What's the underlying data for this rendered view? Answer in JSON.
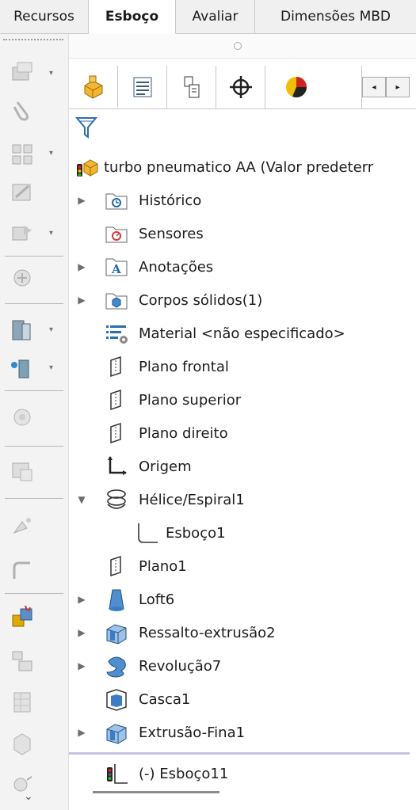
{
  "tabs": [
    {
      "label": "Recursos",
      "active": false
    },
    {
      "label": "Esboço",
      "active": true
    },
    {
      "label": "Avaliar",
      "active": false
    },
    {
      "label": "Dimensões MBD",
      "active": false
    }
  ],
  "feature_manager": {
    "tabs": [
      {
        "icon": "feature-manager-icon",
        "active": true
      },
      {
        "icon": "property-manager-icon",
        "active": false
      },
      {
        "icon": "configuration-manager-icon",
        "active": false
      },
      {
        "icon": "dimxpert-manager-icon",
        "active": false
      },
      {
        "icon": "display-manager-icon",
        "active": false
      }
    ],
    "filter_icon": "filter-icon",
    "tree": [
      {
        "label": "turbo pneumatico AA  (Valor predeterr",
        "icon": "part-icon",
        "expander": ""
      },
      {
        "label": "Histórico",
        "icon": "history-folder-icon",
        "expander": "▶"
      },
      {
        "label": "Sensores",
        "icon": "sensors-folder-icon",
        "expander": ""
      },
      {
        "label": "Anotações",
        "icon": "annotations-icon",
        "expander": "▶"
      },
      {
        "label": "Corpos sólidos(1)",
        "icon": "solid-bodies-icon",
        "expander": "▶"
      },
      {
        "label": "Material <não especificado>",
        "icon": "material-icon",
        "expander": ""
      },
      {
        "label": "Plano frontal",
        "icon": "plane-icon",
        "expander": ""
      },
      {
        "label": "Plano superior",
        "icon": "plane-icon",
        "expander": ""
      },
      {
        "label": "Plano direito",
        "icon": "plane-icon",
        "expander": ""
      },
      {
        "label": "Origem",
        "icon": "origin-icon",
        "expander": ""
      },
      {
        "label": "Hélice/Espiral1",
        "icon": "helix-icon",
        "expander": "▼"
      },
      {
        "label": "Esboço1",
        "icon": "sketch-icon",
        "expander": ""
      },
      {
        "label": "Plano1",
        "icon": "plane-icon",
        "expander": ""
      },
      {
        "label": "Loft6",
        "icon": "loft-icon",
        "expander": "▶"
      },
      {
        "label": "Ressalto-extrusão2",
        "icon": "extrude-icon",
        "expander": "▶"
      },
      {
        "label": "Revolução7",
        "icon": "revolve-icon",
        "expander": "▶"
      },
      {
        "label": "Casca1",
        "icon": "shell-icon",
        "expander": ""
      },
      {
        "label": "Extrusão-Fina1",
        "icon": "extrude-icon",
        "expander": "▶"
      },
      {
        "label": "(-) Esboço11",
        "icon": "sketch-rollback-icon",
        "expander": ""
      }
    ]
  },
  "left_toolbar": [
    "sketch-entities-icon",
    "clip-icon",
    "pattern-icon",
    "repair-icon",
    "convert-icon",
    "move-icon",
    "smart-dimension-icon",
    "mirror-icon",
    "relations-icon",
    "instant2d-icon",
    "rapid-sketch-icon",
    "fillet-icon",
    "chamfer-icon",
    "color-sketch-icon",
    "block-icon",
    "grid-icon",
    "3d-sketch-icon",
    "quick-snaps-icon",
    "chevron-down-icon"
  ]
}
